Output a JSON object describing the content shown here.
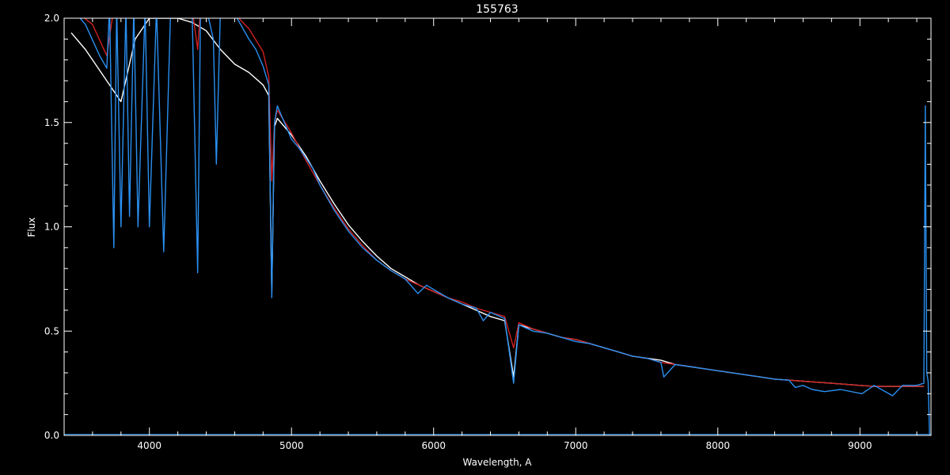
{
  "chart_data": {
    "type": "line",
    "title": "155763",
    "xlabel": "Wavelength, A",
    "ylabel": "Flux",
    "xlim": [
      3400,
      9500
    ],
    "ylim": [
      0.0,
      2.0
    ],
    "x_ticks": [
      4000,
      5000,
      6000,
      7000,
      8000,
      9000
    ],
    "x_tick_labels": [
      "4000",
      "5000",
      "6000",
      "7000",
      "8000",
      "9000"
    ],
    "y_ticks": [
      0.0,
      0.5,
      1.0,
      1.5,
      2.0
    ],
    "y_tick_labels": [
      "0.0",
      "0.5",
      "1.0",
      "1.5",
      "2.0"
    ],
    "grid": false,
    "colors": {
      "background": "#000000",
      "axes": "#ffffff",
      "observed": "#ffffff",
      "model": "#d02020",
      "fit": "#2a8ff0"
    },
    "series": [
      {
        "color": "#ffffff",
        "x": [
          3450,
          3550,
          3650,
          3700,
          3750,
          3800,
          3900,
          4000,
          4100,
          4200,
          4300,
          4400,
          4500,
          4600,
          4700,
          4800,
          4840,
          4861,
          4880,
          4900,
          5000,
          5100,
          5200,
          5300,
          5400,
          5500,
          5600,
          5700,
          5800,
          5900,
          6000,
          6100,
          6200,
          6300,
          6400,
          6500,
          6563,
          6600,
          6700,
          6800,
          6900,
          7000,
          7100,
          7200,
          7300,
          7400,
          7500,
          7600,
          7700,
          7800,
          7900,
          8000,
          8100,
          8200,
          8300,
          8400,
          8500,
          8600,
          8700,
          8800,
          8900,
          9000,
          9100,
          9200,
          9300,
          9400,
          9450
        ],
        "y": [
          1.93,
          1.85,
          1.75,
          1.7,
          1.65,
          1.6,
          1.9,
          2.0,
          2.0,
          2.0,
          1.98,
          1.94,
          1.85,
          1.78,
          1.74,
          1.68,
          1.63,
          0.68,
          1.48,
          1.52,
          1.44,
          1.34,
          1.22,
          1.11,
          1.01,
          0.93,
          0.86,
          0.8,
          0.76,
          0.72,
          0.69,
          0.66,
          0.63,
          0.6,
          0.57,
          0.55,
          0.28,
          0.53,
          0.51,
          0.49,
          0.47,
          0.46,
          0.44,
          0.42,
          0.4,
          0.38,
          0.37,
          0.36,
          0.34,
          0.33,
          0.32,
          0.31,
          0.3,
          0.29,
          0.28,
          0.27,
          0.265,
          0.26,
          0.255,
          0.25,
          0.245,
          0.24,
          0.235,
          0.235,
          0.235,
          0.235,
          0.235
        ]
      },
      {
        "color": "#d02020",
        "x": [
          3450,
          3600,
          3700,
          3750,
          3800,
          3900,
          4000,
          4100,
          4200,
          4300,
          4340,
          4360,
          4400,
          4500,
          4600,
          4700,
          4800,
          4840,
          4861,
          4880,
          4900,
          5000,
          5100,
          5200,
          5300,
          5400,
          5500,
          5600,
          5700,
          5800,
          5900,
          6000,
          6100,
          6200,
          6300,
          6400,
          6500,
          6563,
          6600,
          6700,
          6800,
          6900,
          7000,
          7100,
          7200,
          7300,
          7400,
          7500,
          7600,
          7700,
          7800,
          7900,
          8000,
          8100,
          8200,
          8300,
          8400,
          8500,
          8600,
          8700,
          8800,
          8900,
          9000,
          9100,
          9200,
          9300,
          9400,
          9450
        ],
        "y": [
          2.05,
          1.97,
          1.82,
          2.05,
          2.05,
          2.05,
          2.05,
          2.05,
          2.05,
          2.05,
          1.85,
          2.05,
          2.05,
          2.05,
          2.02,
          1.95,
          1.84,
          1.72,
          1.22,
          1.5,
          1.56,
          1.45,
          1.32,
          1.2,
          1.09,
          0.99,
          0.91,
          0.84,
          0.79,
          0.75,
          0.72,
          0.69,
          0.66,
          0.64,
          0.61,
          0.59,
          0.57,
          0.42,
          0.54,
          0.51,
          0.49,
          0.47,
          0.46,
          0.44,
          0.42,
          0.4,
          0.38,
          0.37,
          0.35,
          0.34,
          0.33,
          0.32,
          0.31,
          0.3,
          0.29,
          0.28,
          0.27,
          0.265,
          0.26,
          0.255,
          0.25,
          0.245,
          0.24,
          0.235,
          0.235,
          0.235,
          0.235,
          0.235
        ]
      },
      {
        "color": "#2a8ff0",
        "x": [
          3450,
          3550,
          3650,
          3700,
          3720,
          3750,
          3770,
          3800,
          3835,
          3860,
          3890,
          3920,
          3970,
          4000,
          4050,
          4101,
          4150,
          4200,
          4250,
          4300,
          4340,
          4360,
          4400,
          4450,
          4471,
          4500,
          4550,
          4600,
          4650,
          4700,
          4750,
          4800,
          4840,
          4861,
          4880,
          4900,
          4950,
          5000,
          5050,
          5100,
          5150,
          5200,
          5300,
          5400,
          5500,
          5600,
          5700,
          5800,
          5890,
          5950,
          6000,
          6100,
          6200,
          6300,
          6350,
          6400,
          6500,
          6563,
          6600,
          6700,
          6800,
          6900,
          7000,
          7100,
          7200,
          7300,
          7400,
          7500,
          7600,
          7620,
          7700,
          7800,
          7900,
          8000,
          8100,
          8200,
          8300,
          8400,
          8500,
          8545,
          8598,
          8665,
          8750,
          8863,
          9015,
          9100,
          9229,
          9300,
          9400,
          9450,
          9460,
          9470,
          9480,
          9490
        ],
        "y": [
          2.05,
          1.97,
          1.82,
          1.76,
          2.05,
          0.9,
          2.05,
          1.0,
          2.05,
          1.05,
          2.05,
          1.0,
          2.05,
          1.0,
          2.05,
          0.88,
          2.05,
          2.05,
          2.05,
          2.05,
          0.78,
          2.05,
          2.05,
          1.9,
          1.3,
          2.05,
          2.05,
          2.02,
          1.96,
          1.9,
          1.85,
          1.77,
          1.68,
          0.66,
          1.5,
          1.58,
          1.5,
          1.42,
          1.38,
          1.33,
          1.28,
          1.2,
          1.08,
          0.98,
          0.9,
          0.84,
          0.79,
          0.75,
          0.68,
          0.72,
          0.7,
          0.66,
          0.63,
          0.61,
          0.55,
          0.59,
          0.56,
          0.25,
          0.53,
          0.5,
          0.49,
          0.47,
          0.45,
          0.44,
          0.42,
          0.4,
          0.38,
          0.37,
          0.35,
          0.28,
          0.34,
          0.33,
          0.32,
          0.31,
          0.3,
          0.29,
          0.28,
          0.27,
          0.265,
          0.23,
          0.24,
          0.22,
          0.21,
          0.22,
          0.2,
          0.24,
          0.19,
          0.24,
          0.24,
          0.25,
          1.58,
          0.3,
          0.26,
          0.0
        ]
      }
    ]
  }
}
